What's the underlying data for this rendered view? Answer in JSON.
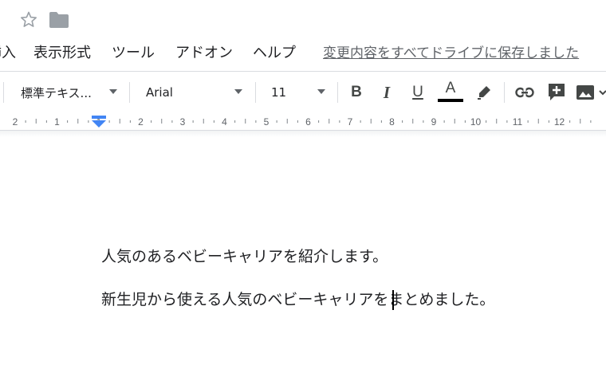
{
  "title_bar": {
    "icons": [
      "star-icon",
      "folder-icon"
    ]
  },
  "menu": {
    "items": [
      {
        "label": "挿入"
      },
      {
        "label": "表示形式"
      },
      {
        "label": "ツール"
      },
      {
        "label": "アドオン"
      },
      {
        "label": "ヘルプ"
      }
    ],
    "save_status": "変更内容をすべてドライブに保存しました"
  },
  "toolbar": {
    "style_select": "標準テキス...",
    "font_select": "Arial",
    "size_select": "11",
    "buttons": [
      "bold-icon",
      "italic-icon",
      "underline-icon",
      "text-color-icon",
      "highlight-icon",
      "link-icon",
      "add-comment-icon",
      "image-icon"
    ],
    "bold_label": "B",
    "italic_label": "I",
    "underline_label": "U",
    "text_color_label": "A",
    "text_color": "#000000",
    "accent_color": "#4285f4"
  },
  "ruler": {
    "labels": [
      "2",
      "1",
      "1",
      "2",
      "3",
      "4",
      "5",
      "6",
      "7",
      "8",
      "9",
      "10",
      "11",
      "12"
    ]
  },
  "document": {
    "paragraphs": [
      "人気のあるベビーキャリアを紹介します。",
      "新生児から使える人気のベビーキャリアをまとめました。"
    ]
  }
}
